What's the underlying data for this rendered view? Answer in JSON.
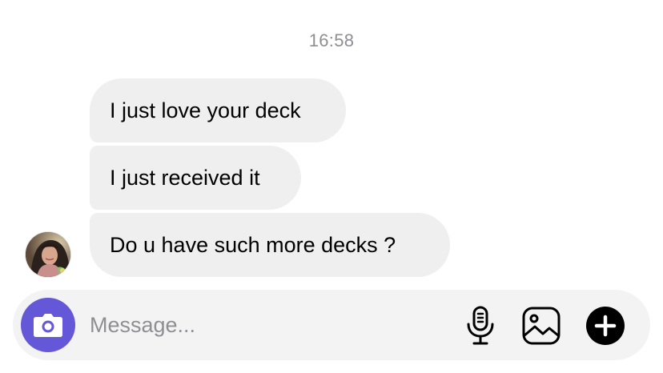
{
  "chat": {
    "timestamp": "16:58",
    "messages": [
      {
        "text": "I just love your deck"
      },
      {
        "text": "I just received it"
      },
      {
        "text": "Do u have such more decks ?"
      }
    ],
    "sender_avatar": "user-avatar"
  },
  "composer": {
    "placeholder": "Message...",
    "value": "",
    "icons": {
      "camera": "camera-icon",
      "mic": "microphone-icon",
      "gallery": "image-icon",
      "more": "plus-icon"
    }
  },
  "colors": {
    "accent": "#6457d8",
    "bubble": "#efefef",
    "timestamp": "#8e8e93",
    "composer_bg": "#f3f3f3"
  }
}
